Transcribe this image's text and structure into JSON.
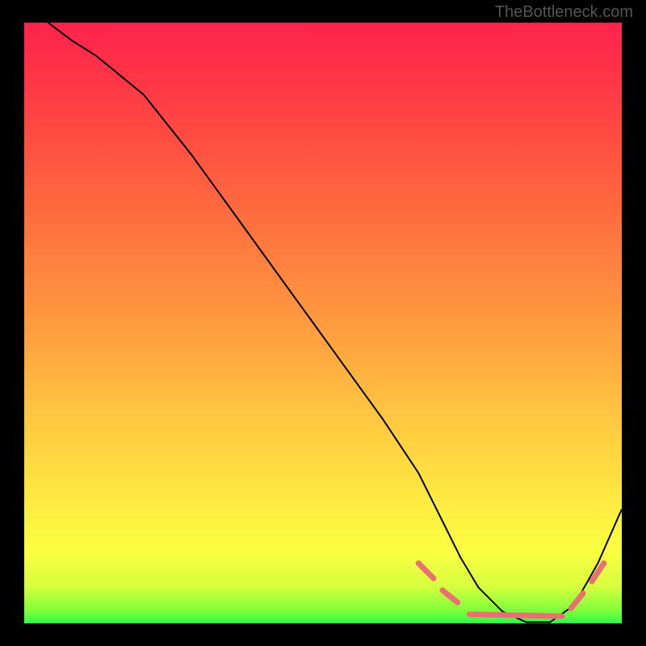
{
  "watermark": "TheBottleneck.com",
  "chart_data": {
    "type": "line",
    "title": "",
    "xlabel": "",
    "ylabel": "",
    "xlim": [
      0,
      100
    ],
    "ylim": [
      0,
      100
    ],
    "grid": false,
    "legend": false,
    "series": [
      {
        "name": "curve",
        "color": "#000000",
        "x": [
          4,
          8,
          12,
          20,
          28,
          36,
          44,
          52,
          60,
          66,
          70,
          73,
          76,
          80,
          84,
          88,
          92,
          96,
          100
        ],
        "values": [
          100,
          97,
          94.5,
          88,
          78,
          67,
          56,
          45,
          34,
          25,
          17,
          11,
          6,
          2,
          0.2,
          0.2,
          3,
          10,
          19
        ]
      }
    ],
    "markers": {
      "name": "dashed-highlight",
      "color": "#e87070",
      "segments": [
        {
          "x": [
            66,
            68.5
          ],
          "y": [
            10,
            7.5
          ]
        },
        {
          "x": [
            70,
            72.5
          ],
          "y": [
            5.5,
            3.5
          ]
        },
        {
          "x": [
            74.5,
            90
          ],
          "y": [
            1.5,
            1.2
          ]
        },
        {
          "x": [
            91.5,
            93.5
          ],
          "y": [
            2.5,
            5
          ]
        },
        {
          "x": [
            95,
            97
          ],
          "y": [
            7,
            10
          ]
        }
      ]
    }
  }
}
